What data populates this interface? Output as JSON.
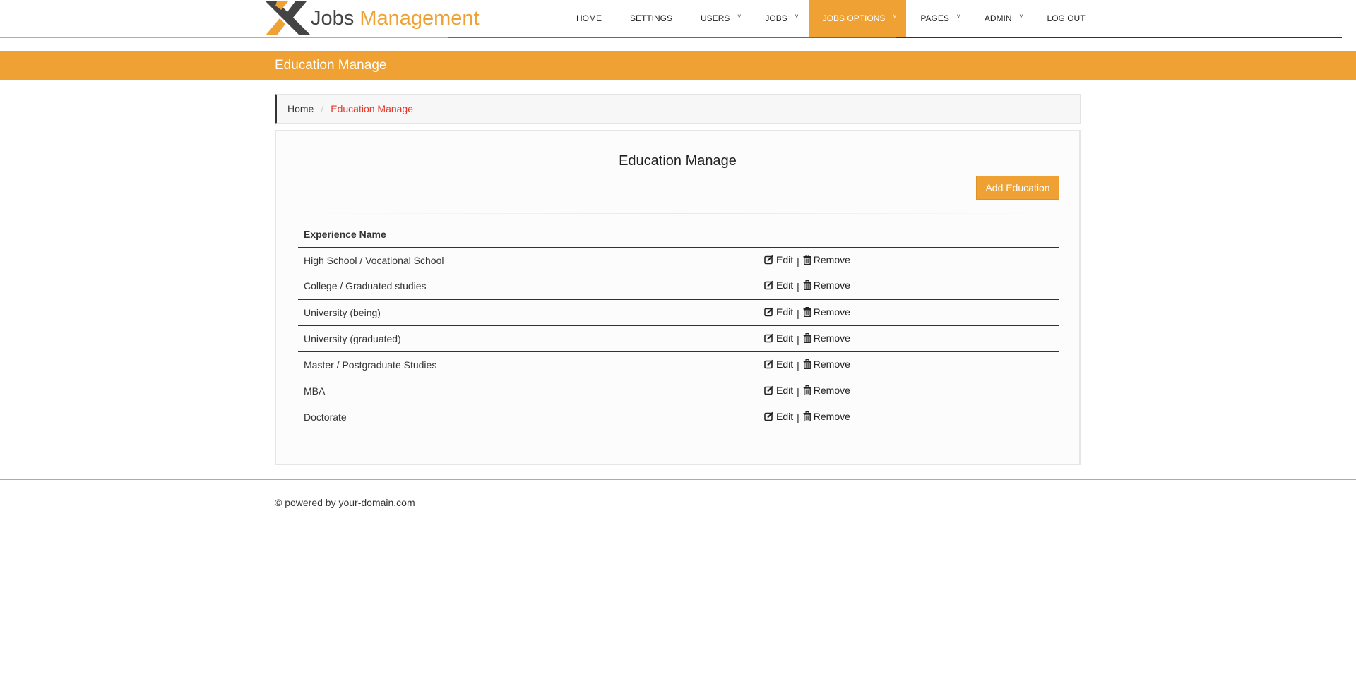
{
  "brand": {
    "word1": "Jobs",
    "word2": "Management"
  },
  "nav": {
    "items": [
      {
        "label": "HOME",
        "caret": false,
        "active": false,
        "key": "home"
      },
      {
        "label": "SETTINGS",
        "caret": false,
        "active": false,
        "key": "settings"
      },
      {
        "label": "USERS",
        "caret": true,
        "active": false,
        "key": "users"
      },
      {
        "label": "JOBS",
        "caret": true,
        "active": false,
        "key": "jobs"
      },
      {
        "label": "JOBS OPTIONS",
        "caret": true,
        "active": true,
        "key": "jobs-options"
      },
      {
        "label": "PAGES",
        "caret": true,
        "active": false,
        "key": "pages"
      },
      {
        "label": "ADMIN",
        "caret": true,
        "active": false,
        "key": "admin"
      },
      {
        "label": "LOG OUT",
        "caret": false,
        "active": false,
        "key": "log-out"
      }
    ],
    "caret_glyph": "˅"
  },
  "page": {
    "title": "Education Manage"
  },
  "breadcrumb": {
    "home": "Home",
    "separator": "/",
    "current": "Education Manage"
  },
  "panel": {
    "title": "Education Manage",
    "add_button": "Add Education"
  },
  "table": {
    "header": "Experience Name",
    "edit_label": "Edit",
    "remove_label": "Remove",
    "pipe": "|",
    "rows": [
      "High School / Vocational School",
      "College / Graduated studies",
      "University (being)",
      "University (graduated)",
      "Master / Postgraduate Studies",
      "MBA",
      "Doctorate"
    ]
  },
  "footer": {
    "text": "© powered by your-domain.com"
  },
  "colors": {
    "accent": "#efa233",
    "red": "#e2372a",
    "dark": "#333333"
  },
  "icons": {
    "edit": "edit-icon",
    "remove": "trash-icon",
    "caret": "chevron-down-icon",
    "logo": "logo-mark"
  }
}
